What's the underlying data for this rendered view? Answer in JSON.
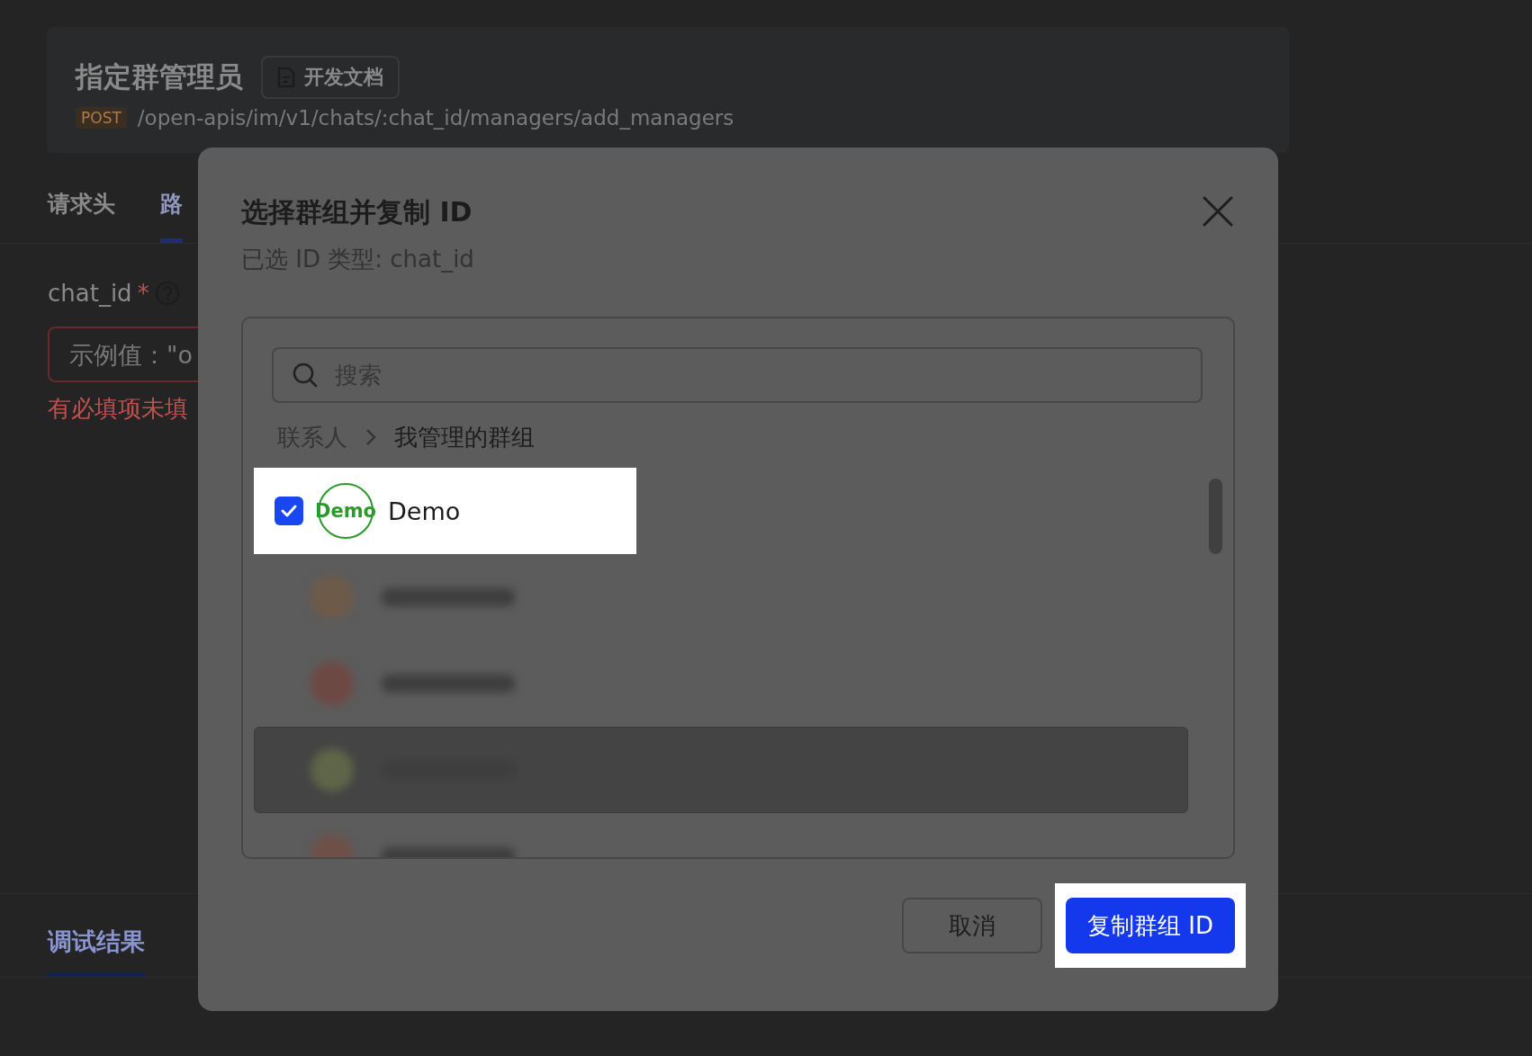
{
  "page": {
    "title": "指定群管理员",
    "doc_button": "开发文档",
    "method": "POST",
    "path": "/open-apis/im/v1/chats/:chat_id/managers/add_managers",
    "tabs": [
      {
        "label": "请求头",
        "selected": false
      },
      {
        "label": "路",
        "selected": true
      }
    ],
    "field": {
      "label": "chat_id",
      "required_mark": "*",
      "placeholder": "示例值：\"o",
      "error": "有必填项未填"
    },
    "result_tabs": [
      {
        "label": "调试结果",
        "selected": true
      }
    ]
  },
  "dialog": {
    "title": "选择群组并复制 ID",
    "subtitle": "已选 ID 类型: chat_id",
    "search": {
      "placeholder": "搜索"
    },
    "breadcrumb": [
      "联系人",
      "我管理的群组"
    ],
    "items": [
      {
        "kind": "group",
        "name": "Demo",
        "avatar": "Demo",
        "checked": true,
        "highlighted": true
      },
      {
        "kind": "blurred",
        "color": "#6e5a48",
        "hovered": false
      },
      {
        "kind": "blurred",
        "color": "#6e4843",
        "hovered": false
      },
      {
        "kind": "blurred",
        "color": "#5e6548",
        "hovered": true
      },
      {
        "kind": "blurred",
        "color": "#6e5048",
        "hovered": false
      }
    ],
    "buttons": [
      {
        "label": "取消",
        "kind": "secondary"
      },
      {
        "label": "复制群组 ID",
        "kind": "primary",
        "highlighted": true
      }
    ]
  }
}
